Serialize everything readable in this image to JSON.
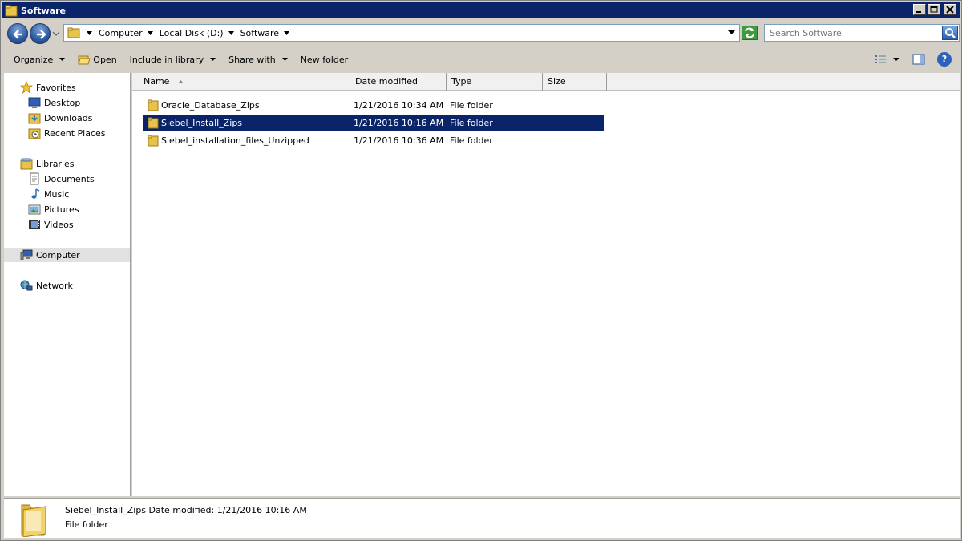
{
  "window": {
    "title": "Software"
  },
  "address": {
    "crumbs": [
      "Computer",
      "Local Disk (D:)",
      "Software"
    ],
    "search_placeholder": "Search Software"
  },
  "toolbar": {
    "organize": "Organize",
    "open": "Open",
    "include_in_library": "Include in library",
    "share_with": "Share with",
    "new_folder": "New folder",
    "help": "?"
  },
  "nav": {
    "favorites": "Favorites",
    "desktop": "Desktop",
    "downloads": "Downloads",
    "recent_places": "Recent Places",
    "libraries": "Libraries",
    "documents": "Documents",
    "music": "Music",
    "pictures": "Pictures",
    "videos": "Videos",
    "computer": "Computer",
    "network": "Network"
  },
  "columns": {
    "name": "Name",
    "date_modified": "Date modified",
    "type": "Type",
    "size": "Size"
  },
  "files": [
    {
      "name": "Oracle_Database_Zips",
      "date": "1/21/2016 10:34 AM",
      "type": "File folder",
      "selected": false
    },
    {
      "name": "Siebel_Install_Zips",
      "date": "1/21/2016 10:16 AM",
      "type": "File folder",
      "selected": true
    },
    {
      "name": "Siebel_installation_files_Unzipped",
      "date": "1/21/2016 10:36 AM",
      "type": "File folder",
      "selected": false
    }
  ],
  "details": {
    "name": "Siebel_Install_Zips",
    "date_label": "Date modified:",
    "date_value": "1/21/2016 10:16 AM",
    "type": "File folder"
  },
  "icons": {
    "folder": "folder-icon",
    "back": "back-arrow-icon",
    "forward": "forward-arrow-icon",
    "refresh": "refresh-icon",
    "search": "search-icon"
  },
  "colors": {
    "titlebar": "#0a246a",
    "selection": "#0a246a",
    "folder": "#e8c34a"
  }
}
